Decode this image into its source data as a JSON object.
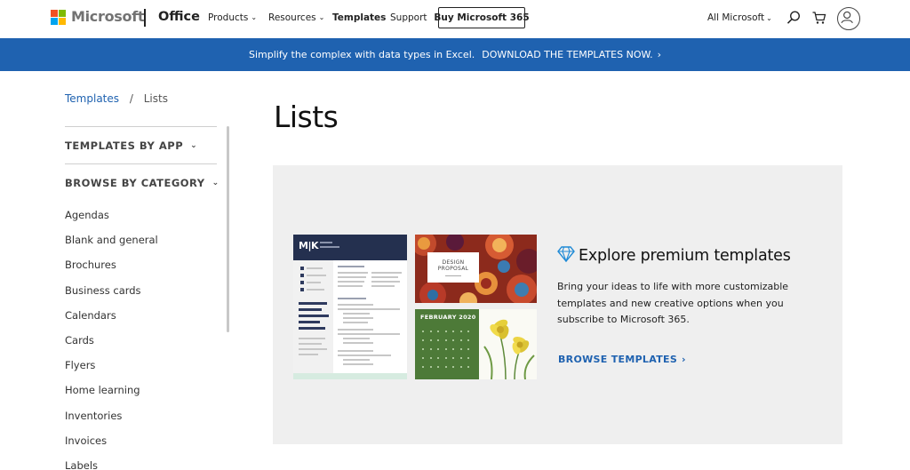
{
  "header": {
    "brand": "Microsoft",
    "product": "Office",
    "nav": [
      {
        "label": "Products",
        "has_dropdown": true
      },
      {
        "label": "Resources",
        "has_dropdown": true
      },
      {
        "label": "Templates",
        "has_dropdown": false
      },
      {
        "label": "Support",
        "has_dropdown": false
      }
    ],
    "buy_button": "Buy Microsoft 365",
    "all_microsoft": "All Microsoft",
    "icons": [
      "search-icon",
      "cart-icon",
      "account-icon"
    ],
    "logo_colors": [
      "#f25022",
      "#7fba00",
      "#00a4ef",
      "#ffb900"
    ]
  },
  "banner": {
    "text": "Simplify the complex with data types in Excel.",
    "link": "DOWNLOAD THE TEMPLATES NOW.",
    "bg_color": "#1f62b0"
  },
  "breadcrumb": {
    "root": "Templates",
    "separator": "/",
    "current": "Lists"
  },
  "sidebar": {
    "by_app": "TEMPLATES BY APP",
    "by_category": "BROWSE BY CATEGORY",
    "categories": [
      "Agendas",
      "Blank and general",
      "Brochures",
      "Business cards",
      "Calendars",
      "Cards",
      "Flyers",
      "Home learning",
      "Inventories",
      "Invoices",
      "Labels"
    ]
  },
  "main": {
    "title": "Lists"
  },
  "promo": {
    "thumb_resume": {
      "initials": "M|K"
    },
    "thumb_design": {
      "title_line1": "DESIGN",
      "title_line2": "PROPOSAL"
    },
    "thumb_calendar": {
      "title": "FEBRUARY 2020"
    },
    "title": "Explore premium templates",
    "body": "Bring your ideas to life with more customizable templates and new creative options when you subscribe to Microsoft 365.",
    "link": "BROWSE TEMPLATES"
  }
}
